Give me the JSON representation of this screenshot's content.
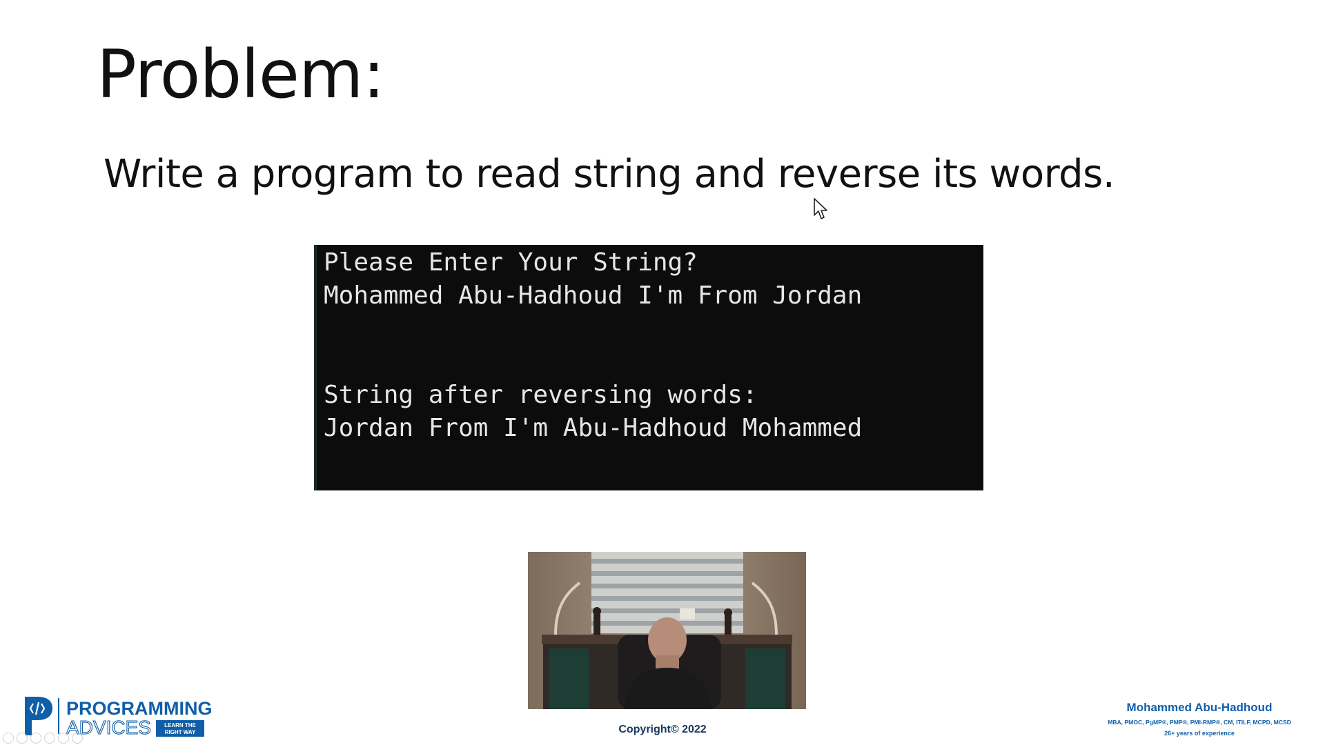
{
  "slide": {
    "title": "Problem:",
    "statement": "Write a program to read string and reverse its words."
  },
  "console": {
    "lines": [
      "Please Enter Your String?",
      "Mohammed Abu-Hadhoud I'm From Jordan",
      "",
      "",
      "String after reversing words:",
      "Jordan From I'm Abu-Hadhoud Mohammed"
    ],
    "background": "#0c0c0c",
    "text_color": "#e6e6e6"
  },
  "footer": {
    "copyright": "Copyright© 2022",
    "logo": {
      "icon": "programming-advices-logo",
      "line1": "PROGRAMMING",
      "line2": "ADVICES",
      "badge_line1": "LEARN THE",
      "badge_line2": "RIGHT WAY"
    },
    "author": {
      "name": "Mohammed Abu-Hadhoud",
      "certs": "MBA, PMOC, PgMP®, PMP®, PMI-RMP®, CM, ITILF, MCPD, MCSD",
      "experience": "26+ years of experience"
    }
  },
  "colors": {
    "brand_blue": "#0f5fa8",
    "navy": "#15365e"
  },
  "webcam": {
    "icon": "presenter-video-feed"
  }
}
